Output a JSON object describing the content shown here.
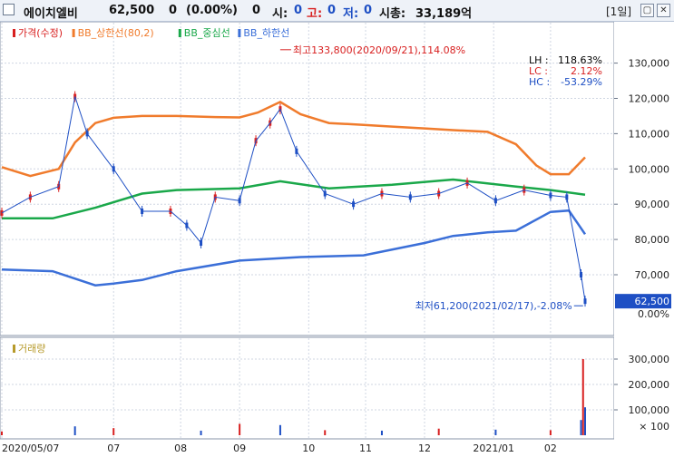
{
  "header": {
    "name": "에이치엘비",
    "price": "62,500",
    "change": "0",
    "change_pct": "(0.00%)",
    "volume": "0",
    "open_label": "시:",
    "open_value": "0",
    "high_label": "고:",
    "high_value": "0",
    "low_label": "저:",
    "low_value": "0",
    "mcap_label": "시총:",
    "mcap_value": "33,189억",
    "period": "[1일]",
    "btn_restore": "▢",
    "btn_close": "✕"
  },
  "colors": {
    "up": "#d82020",
    "down": "#1e4fc4",
    "bb_upper": "#f07b2c",
    "bb_mid": "#1aa84a",
    "bb_lower": "#3b6fd8",
    "volume_label": "#b79a2b"
  },
  "price_panel": {
    "legend": [
      {
        "text": "가격(수정)",
        "color": "#d82020"
      },
      {
        "text": "BB_상한선(80,2)",
        "color": "#f07b2c"
      },
      {
        "text": "BB_중심선",
        "color": "#1aa84a"
      },
      {
        "text": "BB_하한선",
        "color": "#3b6fd8"
      }
    ],
    "info": [
      {
        "label": "LH :",
        "value": "118.63%",
        "color": "#000000"
      },
      {
        "label": "LC :",
        "value": "2.12%",
        "color": "#d82020"
      },
      {
        "label": "HC :",
        "value": "-53.29%",
        "color": "#1e4fc4"
      }
    ],
    "high_annotation": "최고133,800(2020/09/21),114.08%",
    "low_annotation": "최저61,200(2021/02/17),-2.08%",
    "current_price_tag": "62,500",
    "current_pct_tag": "0.00%"
  },
  "volume_panel": {
    "legend": "거래량",
    "scale_note": "× 100"
  },
  "chart_data": {
    "type": "candlestick",
    "y_axis": {
      "ticks": [
        "70,000",
        "80,000",
        "90,000",
        "100,000",
        "110,000",
        "120,000",
        "130,000"
      ],
      "tick_values": [
        70000,
        80000,
        90000,
        100000,
        110000,
        120000,
        130000
      ]
    },
    "x_axis": {
      "ticks": [
        "2020/05/07",
        "07",
        "08",
        "09",
        "10",
        "11",
        "12",
        "2021/01",
        "02"
      ],
      "tick_dates": [
        "2020-05-07",
        "2020-07-01",
        "2020-08-03",
        "2020-09-01",
        "2020-10-05",
        "2020-11-02",
        "2020-12-01",
        "2021-01-04",
        "2021-02-01"
      ]
    },
    "volume_axis": {
      "ticks": [
        "100,000",
        "200,000",
        "300,000"
      ],
      "tick_values": [
        100000,
        200000,
        300000
      ],
      "unit": "× 100"
    },
    "series": [
      {
        "name": "가격(수정)",
        "dates": [
          "2020-05-07",
          "2020-05-21",
          "2020-06-04",
          "2020-06-12",
          "2020-06-18",
          "2020-07-01",
          "2020-07-15",
          "2020-07-29",
          "2020-08-06",
          "2020-08-13",
          "2020-08-20",
          "2020-09-01",
          "2020-09-09",
          "2020-09-16",
          "2020-09-21",
          "2020-09-29",
          "2020-10-13",
          "2020-10-27",
          "2020-11-10",
          "2020-11-24",
          "2020-12-08",
          "2020-12-22",
          "2021-01-05",
          "2021-01-19",
          "2021-02-01",
          "2021-02-09",
          "2021-02-16",
          "2021-02-18"
        ],
        "values": [
          87500,
          92000,
          95000,
          120500,
          110000,
          100000,
          88000,
          88000,
          84000,
          79000,
          92000,
          91000,
          108000,
          113000,
          117000,
          105000,
          93000,
          90000,
          93000,
          92000,
          93000,
          96000,
          91000,
          94000,
          92500,
          92000,
          70000,
          62500
        ]
      },
      {
        "name": "BB_상한선(80,2)",
        "dates": [
          "2020-05-07",
          "2020-05-21",
          "2020-06-04",
          "2020-06-12",
          "2020-06-22",
          "2020-07-01",
          "2020-07-15",
          "2020-08-01",
          "2020-08-20",
          "2020-09-01",
          "2020-09-10",
          "2020-09-21",
          "2020-10-01",
          "2020-10-15",
          "2020-11-01",
          "2020-11-15",
          "2020-12-01",
          "2020-12-15",
          "2021-01-01",
          "2021-01-15",
          "2021-01-25",
          "2021-02-01",
          "2021-02-10",
          "2021-02-18"
        ],
        "values": [
          100500,
          98000,
          100000,
          107500,
          113000,
          114500,
          115000,
          115000,
          114700,
          114600,
          116000,
          119000,
          115500,
          113000,
          112500,
          112000,
          111500,
          111000,
          110500,
          107000,
          101000,
          98500,
          98500,
          103300
        ]
      },
      {
        "name": "BB_중심선",
        "dates": [
          "2020-05-07",
          "2020-06-01",
          "2020-06-22",
          "2020-07-15",
          "2020-08-01",
          "2020-09-01",
          "2020-09-21",
          "2020-10-15",
          "2020-11-15",
          "2020-12-15",
          "2021-01-15",
          "2021-02-01",
          "2021-02-18"
        ],
        "values": [
          86000,
          86000,
          89000,
          93000,
          94000,
          94500,
          96500,
          94500,
          95500,
          97000,
          95000,
          94000,
          92700
        ]
      },
      {
        "name": "BB_하한선",
        "dates": [
          "2020-05-07",
          "2020-06-01",
          "2020-06-22",
          "2020-07-01",
          "2020-07-15",
          "2020-08-01",
          "2020-09-01",
          "2020-10-01",
          "2020-11-01",
          "2020-12-01",
          "2020-12-15",
          "2021-01-01",
          "2021-01-15",
          "2021-02-01",
          "2021-02-10",
          "2021-02-18"
        ],
        "values": [
          71500,
          71000,
          67000,
          67500,
          68500,
          71000,
          74000,
          75000,
          75500,
          79000,
          81000,
          82000,
          82500,
          87800,
          88200,
          81500
        ]
      },
      {
        "name": "거래량",
        "dates": [
          "2020-05-07",
          "2020-06-12",
          "2020-07-01",
          "2020-08-13",
          "2020-09-01",
          "2020-09-21",
          "2020-10-13",
          "2020-11-10",
          "2020-12-08",
          "2021-01-05",
          "2021-02-01",
          "2021-02-16",
          "2021-02-17",
          "2021-02-18"
        ],
        "values": [
          15000,
          35000,
          28000,
          18000,
          45000,
          40000,
          20000,
          18000,
          26000,
          22000,
          20000,
          60000,
          300000,
          110000
        ]
      }
    ]
  }
}
